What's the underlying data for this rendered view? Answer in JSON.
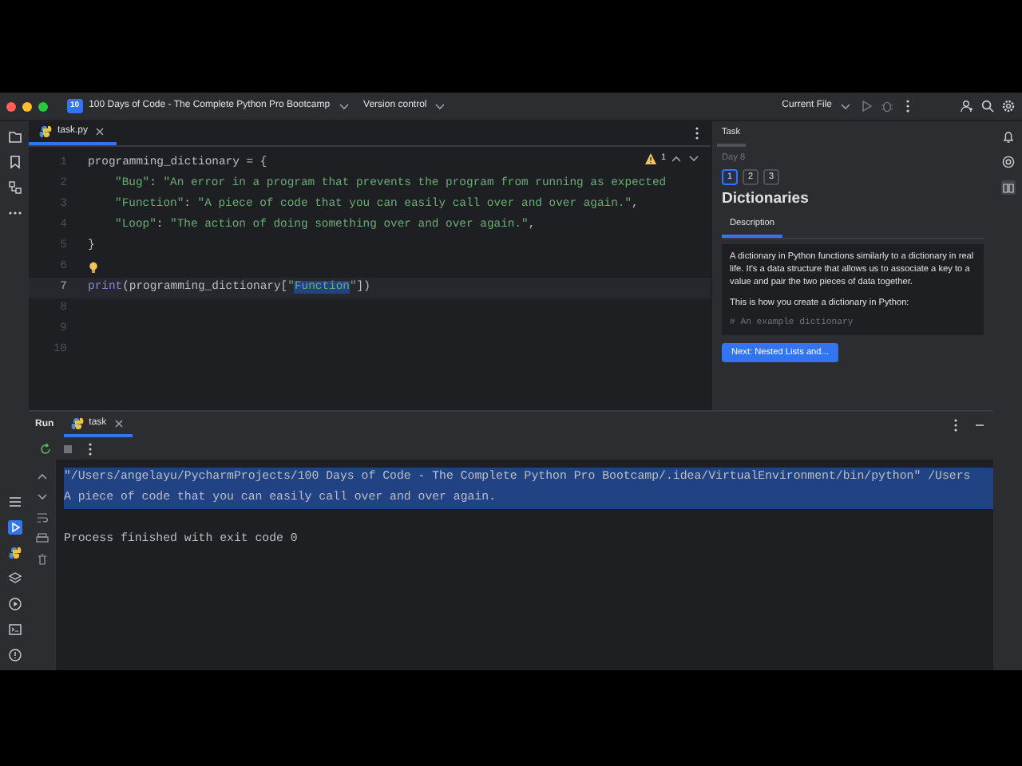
{
  "title_bar": {
    "project_badge": "10",
    "project": "100 Days of Code - The Complete Python Pro Bootcamp",
    "vcs": "Version control",
    "run_config": "Current File"
  },
  "editor": {
    "tab": {
      "label": "task.py"
    },
    "warnings": "1",
    "lines": [
      {
        "number": "1",
        "current": false,
        "indented": false,
        "tokens": [
          {
            "kind": "plain",
            "text": "programming_dictionary = {"
          }
        ]
      },
      {
        "number": "2",
        "current": false,
        "indented": true,
        "tokens": [
          {
            "kind": "string",
            "text": "\"Bug\""
          },
          {
            "kind": "plain",
            "text": ": "
          },
          {
            "kind": "string",
            "text": "\"An error in a program that prevents the program from running as expected"
          }
        ]
      },
      {
        "number": "3",
        "current": false,
        "indented": true,
        "tokens": [
          {
            "kind": "string",
            "text": "\"Function\""
          },
          {
            "kind": "plain",
            "text": ": "
          },
          {
            "kind": "string",
            "text": "\"A piece of code that you can easily call over and over again.\""
          },
          {
            "kind": "plain",
            "text": ","
          }
        ]
      },
      {
        "number": "4",
        "current": false,
        "indented": true,
        "tokens": [
          {
            "kind": "string",
            "text": "\"Loop\""
          },
          {
            "kind": "plain",
            "text": ": "
          },
          {
            "kind": "string",
            "text": "\"The action of doing something over and over again.\""
          },
          {
            "kind": "plain",
            "text": ","
          }
        ]
      },
      {
        "number": "5",
        "current": false,
        "indented": false,
        "tokens": [
          {
            "kind": "plain",
            "text": "}"
          }
        ]
      },
      {
        "number": "6",
        "current": false,
        "bulb": true
      },
      {
        "number": "7",
        "current": true,
        "indented": false,
        "tokens": [
          {
            "kind": "builtin",
            "text": "print"
          },
          {
            "kind": "plain",
            "text": "(programming_dictionary["
          },
          {
            "kind": "string",
            "text": "\""
          },
          {
            "kind": "selected",
            "text": "Function"
          },
          {
            "kind": "string",
            "text": "\""
          },
          {
            "kind": "plain",
            "text": "])"
          }
        ]
      },
      {
        "number": "8",
        "current": false
      },
      {
        "number": "9",
        "current": false
      },
      {
        "number": "10",
        "current": false
      }
    ]
  },
  "task": {
    "title": "Task",
    "day": "Day 8",
    "steps": [
      {
        "label": "1",
        "selected": true
      },
      {
        "label": "2",
        "selected": false
      },
      {
        "label": "3",
        "selected": false
      }
    ],
    "heading": "Dictionaries",
    "tabs": [
      {
        "label": "Description",
        "selected": true
      }
    ],
    "paragraphs": [
      "A dictionary in Python functions similarly to a dictionary in real life. It's a data structure that allows us to associate a key to a value and pair the two pieces of data together.",
      "This is how you create a dictionary in Python:"
    ],
    "code": "# An example dictionary",
    "next_button": "Next: Nested Lists and..."
  },
  "run": {
    "title": "Run",
    "tab": {
      "label": "task"
    },
    "lines": [
      {
        "text": "\"/Users/angelayu/PycharmProjects/100 Days of Code - The Complete Python Pro Bootcamp/.idea/VirtualEnvironment/bin/python\" /Users",
        "selected": true
      },
      {
        "text": "A piece of code that you can easily call over and over again.",
        "selected": true
      }
    ],
    "exit_message": "Process finished with exit code 0"
  }
}
